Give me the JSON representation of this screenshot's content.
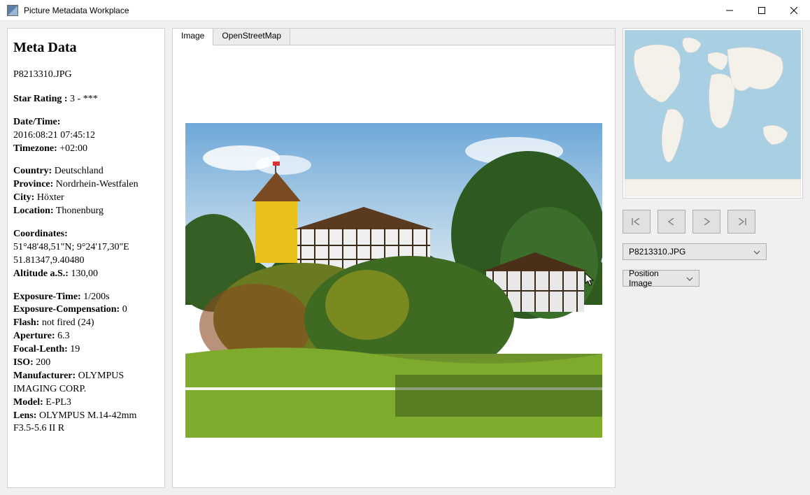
{
  "window": {
    "title": "Picture Metadata Workplace"
  },
  "meta": {
    "heading": "Meta Data",
    "filename": "P8213310.JPG",
    "star_rating_label": "Star Rating :",
    "star_rating_value": "3 - ***",
    "datetime_label": "Date/Time:",
    "datetime_value": "2016:08:21 07:45:12",
    "timezone_label": "Timezone:",
    "timezone_value": "+02:00",
    "country_label": "Country:",
    "country_value": "Deutschland",
    "province_label": "Province:",
    "province_value": "Nordrhein-Westfalen",
    "city_label": "City:",
    "city_value": "Höxter",
    "location_label": "Location:",
    "location_value": "Thonenburg",
    "coords_label": "Coordinates:",
    "coords_dms": "51°48'48,51\"N; 9°24'17,30\"E",
    "coords_dec": "51.81347,9.40480",
    "altitude_label": "Altitude a.S.:",
    "altitude_value": "130,00",
    "exposure_time_label": "Exposure-Time:",
    "exposure_time_value": "1/200s",
    "exposure_comp_label": "Exposure-Compensation:",
    "exposure_comp_value": "0",
    "flash_label": "Flash:",
    "flash_value": "not fired (24)",
    "aperture_label": "Aperture:",
    "aperture_value": "6.3",
    "focal_length_label": "Focal-Lenth:",
    "focal_length_value": "19",
    "iso_label": "ISO:",
    "iso_value": "200",
    "manufacturer_label": "Manufacturer:",
    "manufacturer_value": "OLYMPUS IMAGING CORP.",
    "model_label": "Model:",
    "model_value": "E-PL3",
    "lens_label": "Lens:",
    "lens_value": "OLYMPUS M.14-42mm F3.5-5.6 II R"
  },
  "tabs": {
    "image": "Image",
    "osm": "OpenStreetMap"
  },
  "right": {
    "file_select_value": "P8213310.JPG",
    "action_select_value": "Position Image"
  }
}
